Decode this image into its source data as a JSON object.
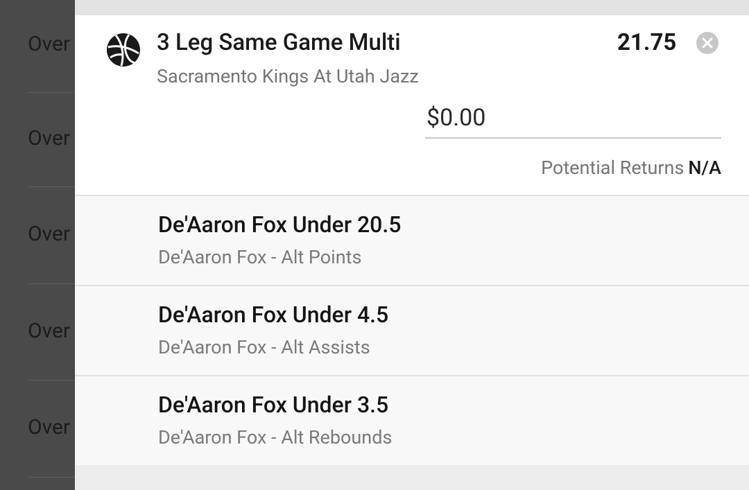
{
  "background_list": {
    "rows": [
      "Over",
      "Over",
      "Over",
      "Over",
      "Over"
    ]
  },
  "slip": {
    "title": "3 Leg Same Game Multi",
    "event": "Sacramento Kings At Utah Jazz",
    "odds": "21.75",
    "stake_value": "$0.00",
    "potential_returns_label": "Potential Returns",
    "potential_returns_value": "N/A",
    "sport_icon": "basketball-icon",
    "close_icon": "close-icon",
    "legs": [
      {
        "title": "De'Aaron Fox Under 20.5",
        "market": "De'Aaron Fox - Alt Points"
      },
      {
        "title": "De'Aaron Fox Under 4.5",
        "market": "De'Aaron Fox - Alt Assists"
      },
      {
        "title": "De'Aaron Fox Under 3.5",
        "market": "De'Aaron Fox - Alt Rebounds"
      }
    ]
  },
  "colors": {
    "overlay": "#4a4a4a",
    "card": "#ffffff",
    "leg_background": "#f8f8f8",
    "muted_text": "#757575"
  }
}
